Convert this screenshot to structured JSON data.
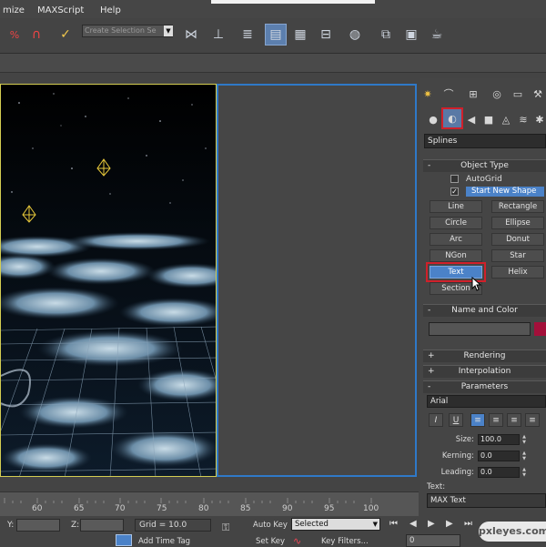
{
  "menu": {
    "items": [
      "mize",
      "MAXScript",
      "Help"
    ]
  },
  "toolbar": {
    "selection_set": "Create Selection Se"
  },
  "panel": {
    "category": "Splines",
    "object_type": {
      "title": "Object Type",
      "autogrid_label": "AutoGrid",
      "start_new_shape_label": "Start New Shape",
      "buttons": [
        "Line",
        "Rectangle",
        "Circle",
        "Ellipse",
        "Arc",
        "Donut",
        "NGon",
        "Star",
        "Text",
        "Helix",
        "Section"
      ],
      "active_button": "Text"
    },
    "name_and_color": {
      "title": "Name and Color"
    },
    "rendering": {
      "title": "Rendering",
      "sign": "+"
    },
    "interpolation": {
      "title": "Interpolation",
      "sign": "+"
    },
    "parameters": {
      "title": "Parameters",
      "sign": "-",
      "font": "Arial",
      "size_label": "Size:",
      "size_value": "100.0",
      "kerning_label": "Kerning:",
      "kerning_value": "0.0",
      "leading_label": "Leading:",
      "leading_value": "0.0",
      "text_label": "Text:",
      "text_value": "MAX Text"
    }
  },
  "timeline": {
    "ticks": [
      "60",
      "65",
      "70",
      "75",
      "80",
      "85",
      "90",
      "95",
      "100"
    ]
  },
  "status": {
    "y_label": "Y:",
    "z_label": "Z:",
    "grid": "Grid = 10.0",
    "auto_key": "Auto Key",
    "selected": "Selected",
    "set_key": "Set Key",
    "key_filters": "Key Filters...",
    "add_time_tag": "Add Time Tag",
    "frame": "0"
  },
  "watermark": "pxleyes.com",
  "colors": {
    "active_blue": "#4b82c8",
    "highlight_red": "#d0202a",
    "viewport_border": "#2f79c8",
    "object_color": "#a3103a"
  }
}
